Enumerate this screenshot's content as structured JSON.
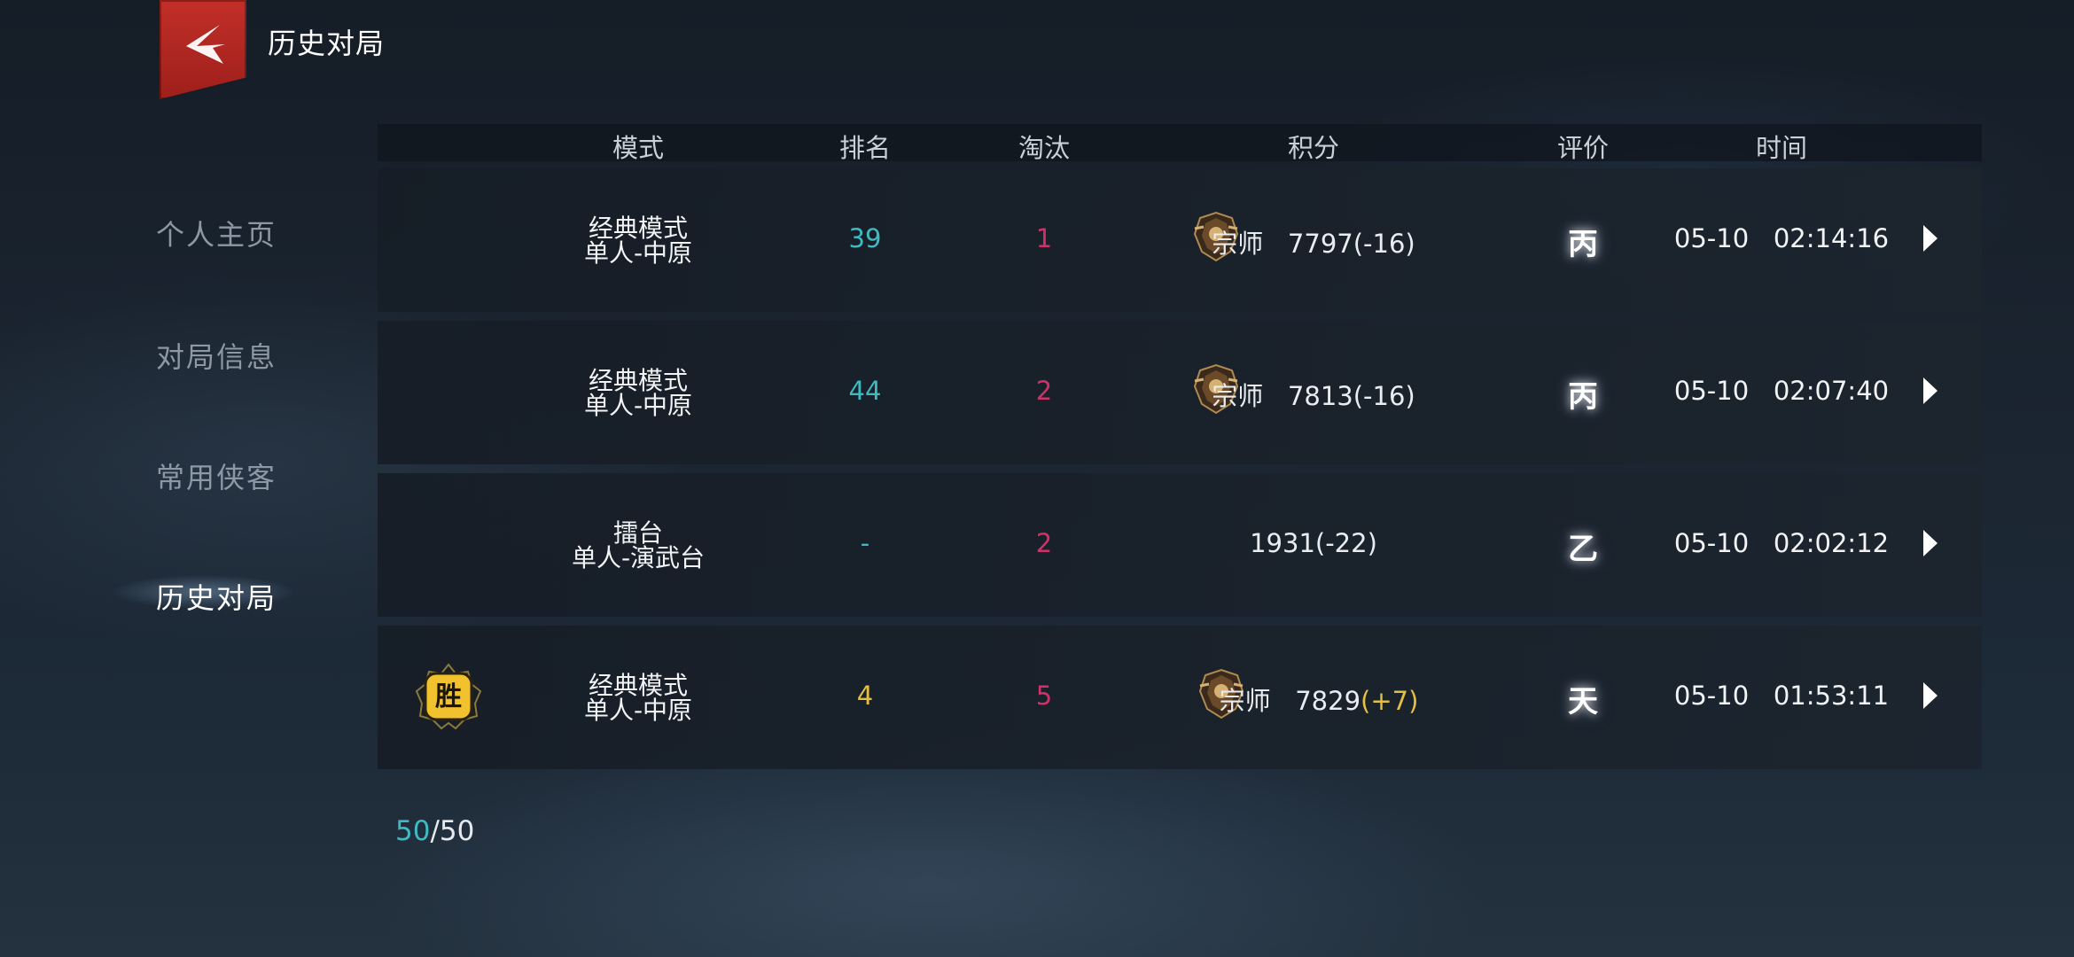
{
  "header": {
    "title": "历史对局",
    "back_icon": "back-chevron-icon",
    "badge_color": "#b52621"
  },
  "sidebar": {
    "items": [
      {
        "label": "个人主页",
        "active": false
      },
      {
        "label": "对局信息",
        "active": false
      },
      {
        "label": "常用侠客",
        "active": false
      },
      {
        "label": "历史对局",
        "active": true
      }
    ]
  },
  "table": {
    "columns": [
      "模式",
      "排名",
      "淘汰",
      "积分",
      "评价",
      "时间"
    ],
    "rows": [
      {
        "mode_line1": "经典模式",
        "mode_line2": "单人-中原",
        "rank": "39",
        "eliminations": "1",
        "tier": "宗师",
        "score": "7797",
        "delta": "(-16)",
        "grade": "丙",
        "date": "05-10",
        "time": "02:14:16",
        "win": false
      },
      {
        "mode_line1": "经典模式",
        "mode_line2": "单人-中原",
        "rank": "44",
        "eliminations": "2",
        "tier": "宗师",
        "score": "7813",
        "delta": "(-16)",
        "grade": "丙",
        "date": "05-10",
        "time": "02:07:40",
        "win": false
      },
      {
        "mode_line1": "擂台",
        "mode_line2": "单人-演武台",
        "rank": "-",
        "eliminations": "2",
        "tier": "",
        "score": "1931",
        "delta": "(-22)",
        "grade": "乙",
        "date": "05-10",
        "time": "02:02:12",
        "win": false
      },
      {
        "mode_line1": "经典模式",
        "mode_line2": "单人-中原",
        "rank": "4",
        "eliminations": "5",
        "tier": "宗师",
        "score": "7829",
        "delta": "(+7)",
        "grade": "天",
        "date": "05-10",
        "time": "01:53:11",
        "win": true,
        "win_label": "胜"
      }
    ]
  },
  "pager": {
    "current": "50",
    "separator": "/",
    "total": "50"
  },
  "colors": {
    "rank": "#3fb9c2",
    "eliminations": "#d1306b",
    "positive_delta": "#e3c040",
    "win_badge": "#f2c12e"
  }
}
